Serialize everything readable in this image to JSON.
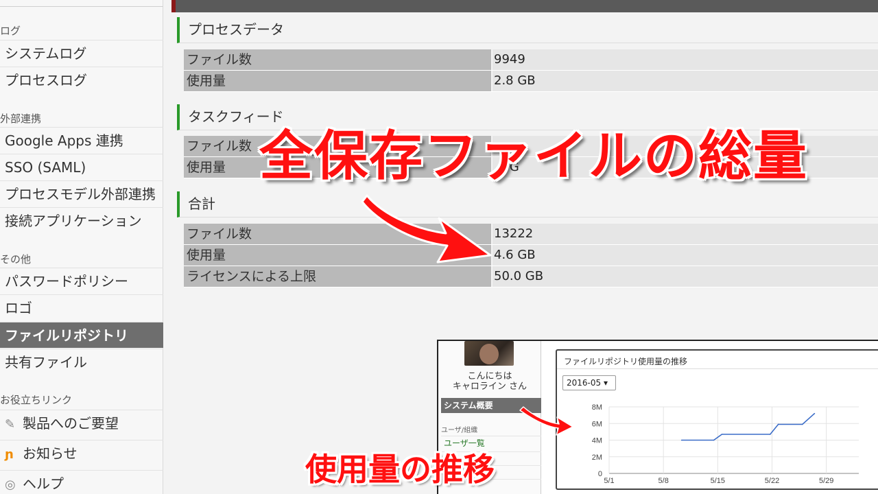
{
  "sidebar": {
    "sections": [
      {
        "label": "ログ",
        "items": [
          {
            "label": "システムログ"
          },
          {
            "label": "プロセスログ"
          }
        ]
      },
      {
        "label": "外部連携",
        "items": [
          {
            "label": "Google Apps 連携"
          },
          {
            "label": "SSO (SAML)"
          },
          {
            "label": "プロセスモデル外部連携"
          },
          {
            "label": "接続アプリケーション"
          }
        ]
      },
      {
        "label": "その他",
        "items": [
          {
            "label": "パスワードポリシー"
          },
          {
            "label": "ロゴ"
          },
          {
            "label": "ファイルリポジトリ",
            "active": true
          },
          {
            "label": "共有ファイル"
          }
        ]
      },
      {
        "label": "お役立ちリンク",
        "items": [
          {
            "label": "製品へのご要望",
            "icon": "megaphone-icon"
          },
          {
            "label": "お知らせ",
            "icon": "rss-icon"
          },
          {
            "label": "ヘルプ",
            "icon": "help-icon"
          }
        ]
      }
    ]
  },
  "main": {
    "sections": [
      {
        "title": "プロセスデータ",
        "rows": [
          {
            "key": "ファイル数",
            "value": "9949"
          },
          {
            "key": "使用量",
            "value": "2.8 GB"
          }
        ]
      },
      {
        "title": "タスクフィード",
        "rows": [
          {
            "key": "ファイル数",
            "value": ""
          },
          {
            "key": "使用量",
            "value": ".8 G"
          }
        ]
      },
      {
        "title": "合計",
        "rows": [
          {
            "key": "ファイル数",
            "value": "13222"
          },
          {
            "key": "使用量",
            "value": "4.6 GB"
          },
          {
            "key": "ライセンスによる上限",
            "value": "50.0 GB"
          }
        ]
      }
    ]
  },
  "overlay": {
    "headline": "全保存ファイルの総量",
    "subline": "使用量の推移",
    "accent_color": "#ff1010"
  },
  "inset": {
    "greeting_line1": "こんにちは",
    "greeting_line2": "キャロライン さん",
    "nav_active": "システム概要",
    "nav_section": "ユーザ/組織",
    "nav_item": "ユーザ一覧",
    "chart_panel_title": "ファイルリポジトリ使用量の推移",
    "month_select": "2016-05 ▾"
  },
  "chart_data": {
    "type": "line",
    "title": "ファイルリポジトリ使用量の推移",
    "x_tick_labels": [
      "5/1",
      "5/8",
      "5/15",
      "5/22",
      "5/29"
    ],
    "y_tick_labels": [
      "0",
      "2M",
      "4M",
      "6M",
      "8M"
    ],
    "ylim": [
      0,
      8
    ],
    "xlim": [
      1,
      32
    ],
    "grid": true,
    "series": [
      {
        "color": "#3a6cc8",
        "points": [
          {
            "x": 10,
            "y": 4.0
          },
          {
            "x": 14,
            "y": 4.0
          },
          {
            "x": 15,
            "y": 4.7
          },
          {
            "x": 21,
            "y": 4.7
          },
          {
            "x": 22,
            "y": 5.9
          },
          {
            "x": 25,
            "y": 5.9
          },
          {
            "x": 26.5,
            "y": 7.2
          }
        ]
      }
    ]
  }
}
